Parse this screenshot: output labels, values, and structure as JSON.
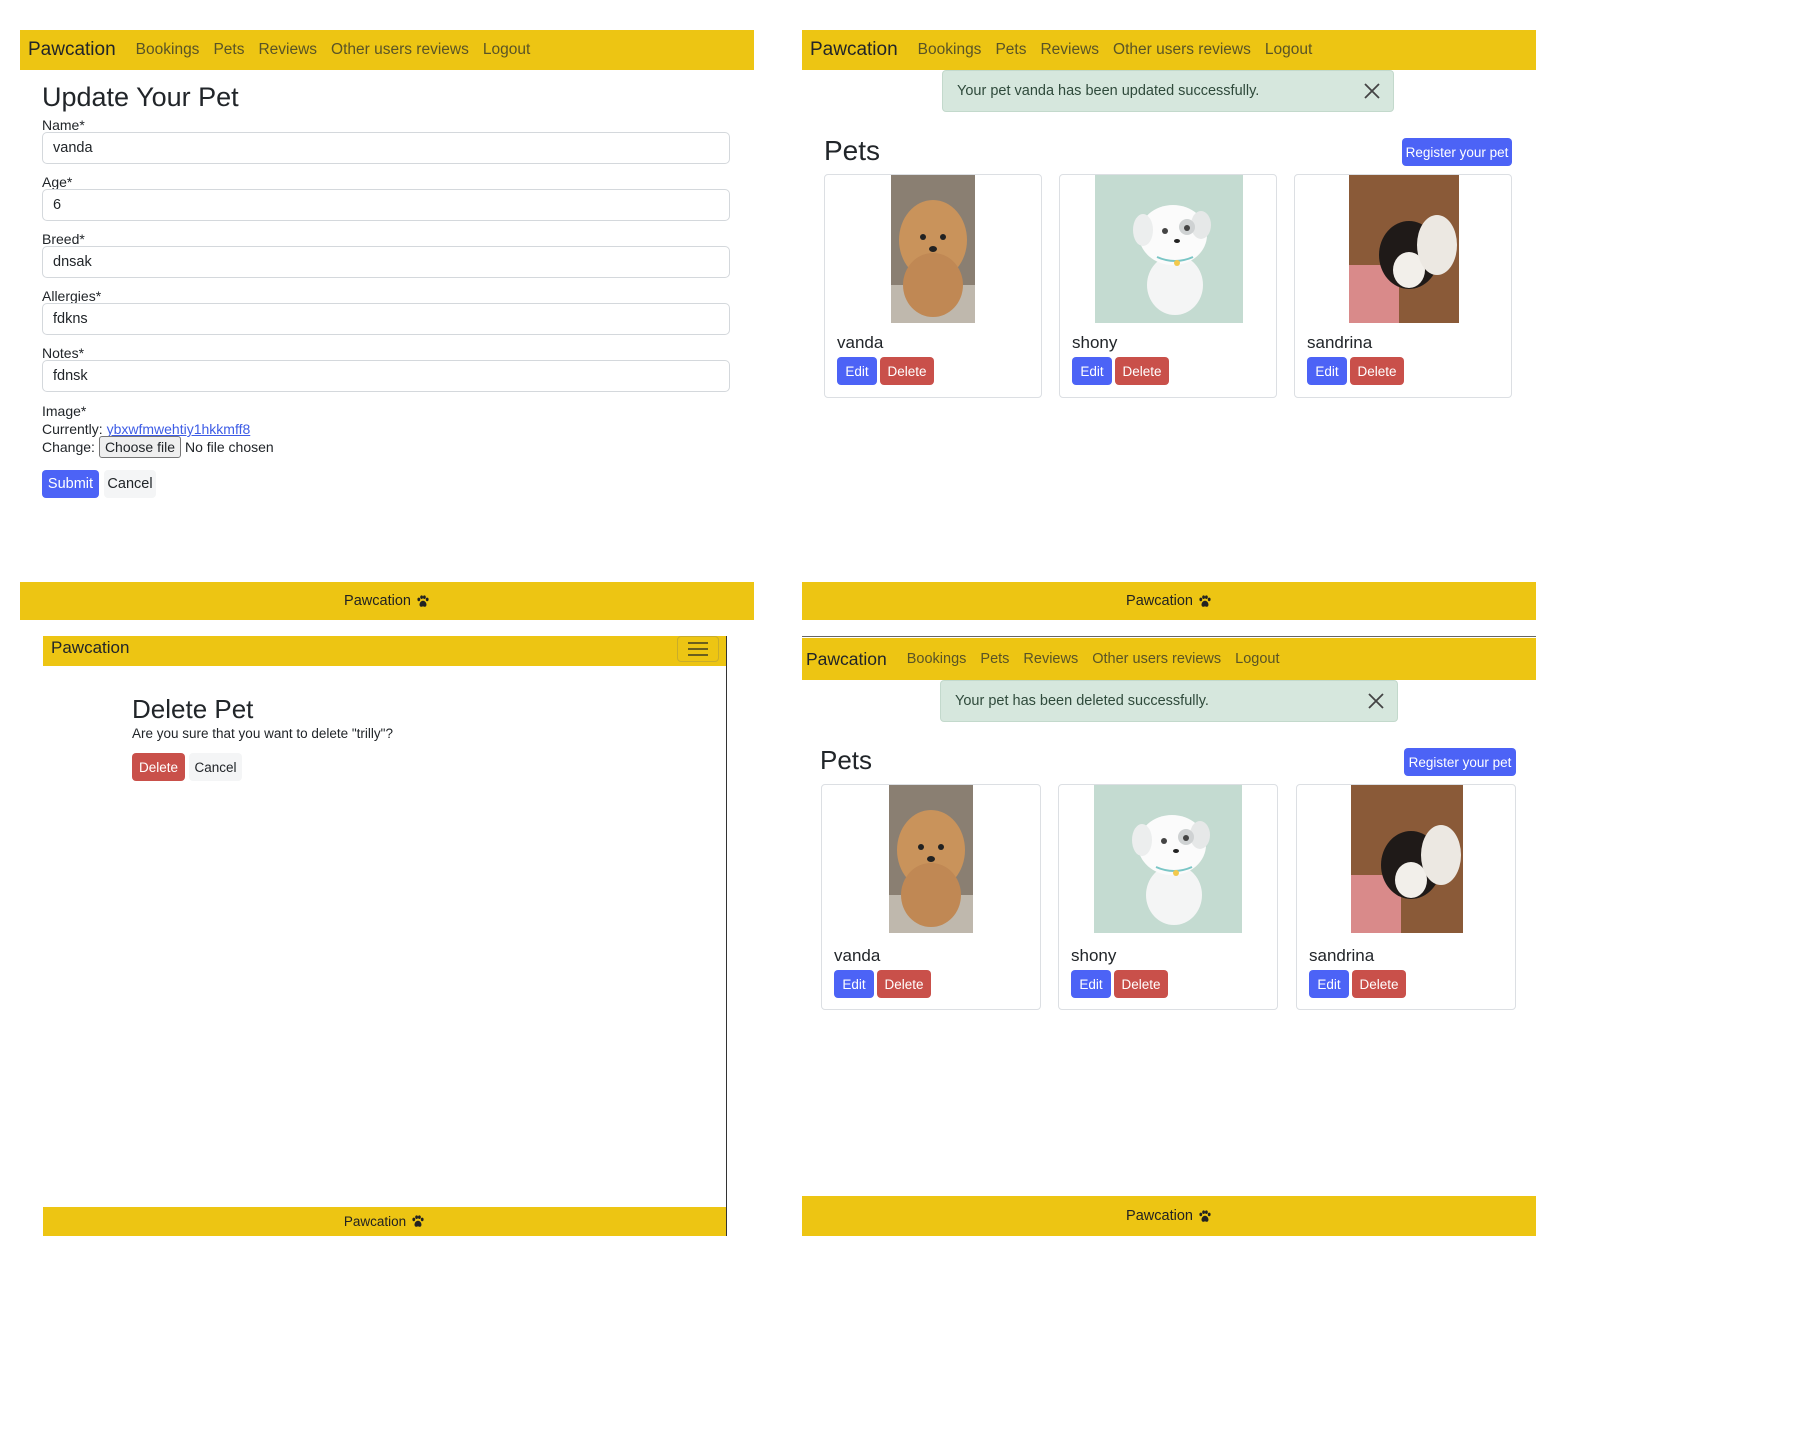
{
  "nav": {
    "brand": "Pawcation",
    "links": [
      "Bookings",
      "Pets",
      "Reviews",
      "Other users reviews",
      "Logout"
    ]
  },
  "footer": {
    "text": "Pawcation",
    "icon": "paw-icon"
  },
  "update_form": {
    "title": "Update Your Pet",
    "fields": [
      {
        "label": "Name*",
        "value": "vanda"
      },
      {
        "label": "Age*",
        "value": "6"
      },
      {
        "label": "Breed*",
        "value": "dnsak"
      },
      {
        "label": "Allergies*",
        "value": "fdkns"
      },
      {
        "label": "Notes*",
        "value": "fdnsk"
      }
    ],
    "image_label": "Image*",
    "currently_label": "Currently:",
    "currently_link": "ybxwfmwehtiy1hkkmff8",
    "change_label": "Change:",
    "choose_file": "Choose file",
    "no_file": "No file chosen",
    "submit": "Submit",
    "cancel": "Cancel"
  },
  "pets_updated": {
    "alert": "Your pet vanda has been updated successfully.",
    "title": "Pets",
    "register": "Register your pet"
  },
  "pets_deleted": {
    "alert": "Your pet has been deleted successfully.",
    "title": "Pets",
    "register": "Register your pet"
  },
  "pets": [
    {
      "name": "vanda",
      "photo": "brown poodle dog photo"
    },
    {
      "name": "shony",
      "photo": "cartoon white puppy illustration"
    },
    {
      "name": "sandrina",
      "photo": "black and white puppy photo"
    }
  ],
  "card_buttons": {
    "edit": "Edit",
    "delete": "Delete"
  },
  "delete_page": {
    "title": "Delete Pet",
    "question": "Are you sure that you want to delete \"trilly\"?",
    "delete": "Delete",
    "cancel": "Cancel"
  },
  "colors": {
    "navbar": "#edc513",
    "primary": "#4c63f6",
    "danger": "#c9504a",
    "alert_success": "#d6e7dd"
  }
}
